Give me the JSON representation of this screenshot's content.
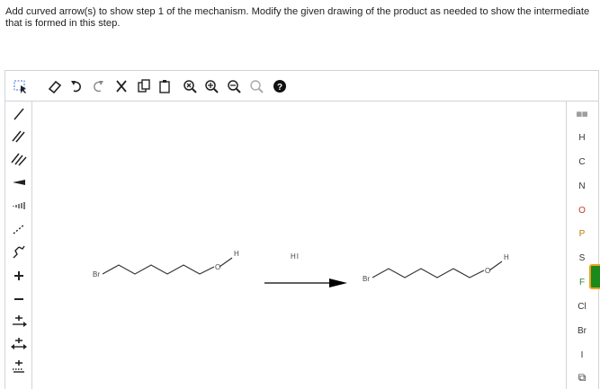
{
  "instructions": "Add curved arrow(s) to show step 1 of the mechanism. Modify the given drawing of the product as needed to show the intermediate that is formed in this step.",
  "toolbar": {
    "top": [
      {
        "name": "select-icon"
      },
      {
        "name": "erase-icon"
      },
      {
        "name": "undo-icon"
      },
      {
        "name": "redo-icon"
      },
      {
        "name": "cut-icon"
      },
      {
        "name": "copy-icon"
      },
      {
        "name": "paste-icon"
      },
      {
        "name": "zoom-reset-icon"
      },
      {
        "name": "zoom-in-icon"
      },
      {
        "name": "zoom-out-icon"
      },
      {
        "name": "clean-icon"
      },
      {
        "name": "help-icon"
      }
    ],
    "left": [
      {
        "name": "selection-tool-icon"
      },
      {
        "name": "single-bond-icon"
      },
      {
        "name": "double-bond-icon"
      },
      {
        "name": "triple-bond-icon"
      },
      {
        "name": "wedge-bond-icon"
      },
      {
        "name": "hash-bond-icon"
      },
      {
        "name": "dashed-bond-icon"
      },
      {
        "name": "chain-tool-icon"
      },
      {
        "name": "positive-charge-icon"
      },
      {
        "name": "negative-charge-icon"
      },
      {
        "name": "lone-pair-arrow-icon"
      },
      {
        "name": "bond-arrow-icon"
      },
      {
        "name": "electron-arrow-icon"
      }
    ],
    "elements": [
      "H",
      "C",
      "N",
      "O",
      "P",
      "S",
      "F",
      "Cl",
      "Br",
      "I"
    ]
  },
  "canvas": {
    "reactant": {
      "br_label": "Br",
      "o_label": "O",
      "h_label": "H"
    },
    "reagent": "HI",
    "product": {
      "br_label": "Br",
      "o_label": "O",
      "h_label": "H"
    }
  },
  "colors": {
    "border": "#cfd4da",
    "arrow": "#000000",
    "bond": "#333333",
    "accent": "#1a8a1a"
  }
}
